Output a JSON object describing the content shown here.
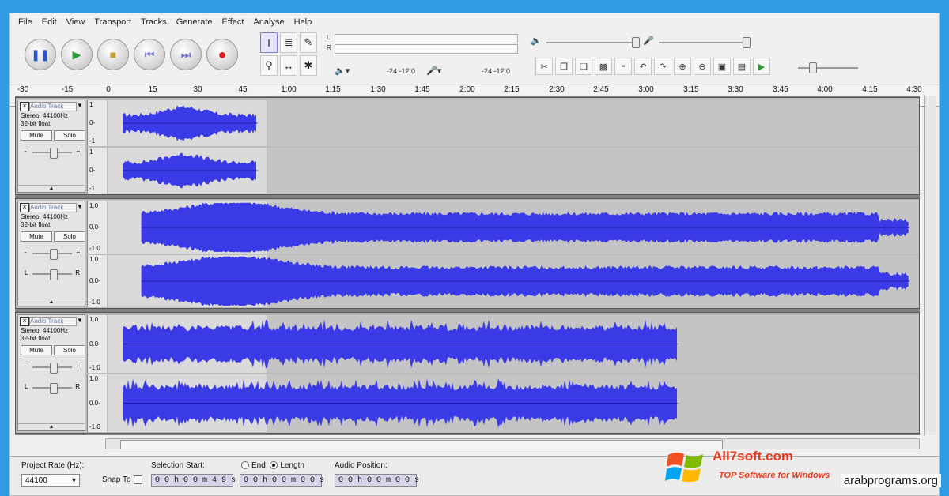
{
  "menu": [
    "File",
    "Edit",
    "View",
    "Transport",
    "Tracks",
    "Generate",
    "Effect",
    "Analyse",
    "Help"
  ],
  "transport_icons": [
    "pause-icon",
    "play-icon",
    "stop-icon",
    "skip-start-icon",
    "skip-end-icon",
    "record-icon"
  ],
  "tools": [
    "I",
    "≣",
    "✎",
    "⚲",
    "↔",
    "✱"
  ],
  "meters": {
    "left_label": "L",
    "right_label": "R",
    "scale_a": "-24 -12 0",
    "scale_b": "-24 -12 0"
  },
  "ruler_ticks": [
    "-30",
    "-15",
    "0",
    "15",
    "30",
    "45",
    "1:00",
    "1:15",
    "1:30",
    "1:45",
    "2:00",
    "2:15",
    "2:30",
    "2:45",
    "3:00",
    "3:15",
    "3:30",
    "3:45",
    "4:00",
    "4:15",
    "4:30"
  ],
  "tracks": [
    {
      "name": "Audio Track",
      "format": "Stereo, 44100Hz",
      "depth": "32-bit float",
      "mute": "Mute",
      "solo": "Solo",
      "scale": [
        "1",
        "0-",
        "-1"
      ],
      "duration_min": 0.0,
      "duration_max": 0.75
    },
    {
      "name": "Audio Track",
      "format": "Stereo, 44100Hz",
      "depth": "32-bit float",
      "mute": "Mute",
      "solo": "Solo",
      "scale": [
        "1.0",
        "0.0-",
        "-1.0"
      ],
      "duration_min": 0.1,
      "duration_max": 4.4
    },
    {
      "name": "Audio Track",
      "format": "Stereo, 44100Hz",
      "depth": "32-bit float",
      "mute": "Mute",
      "solo": "Solo",
      "scale": [
        "1.0",
        "0.0-",
        "-1.0"
      ],
      "duration_min": 0.0,
      "duration_max": 3.1
    }
  ],
  "selection_toolbar": {
    "project_rate_label": "Project Rate (Hz):",
    "project_rate_value": "44100",
    "snap_to_label": "Snap To",
    "selection_start_label": "Selection Start:",
    "selection_start_value": "0 0 h 0 0 m 4 9 s",
    "end_label": "End",
    "length_label": "Length",
    "length_value": "0 0 h 0 0 m 0 0 s",
    "audio_position_label": "Audio Position:",
    "audio_position_value": "0 0 h 0 0 m 0 0 s"
  },
  "watermark": {
    "title": "All7soft.com",
    "subtitle": "TOP Software for Windows"
  },
  "footer_tag": "arabprograms.org",
  "colors": {
    "waveform": "#3a3ae6",
    "background_frame": "#2f9be3",
    "watermark": "#e63b1c"
  }
}
